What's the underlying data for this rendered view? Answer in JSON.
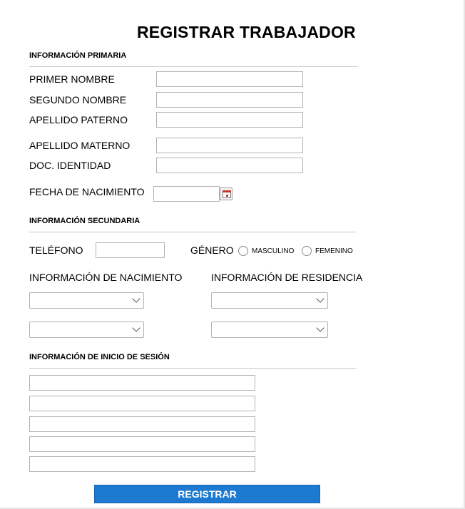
{
  "title": "REGISTRAR TRABAJADOR",
  "primary": {
    "heading": "INFORMACIÓN PRIMARIA",
    "labels": {
      "primer_nombre": "PRIMER NOMBRE",
      "segundo_nombre": "SEGUNDO NOMBRE",
      "apellido_paterno": "APELLIDO PATERNO",
      "apellido_materno": "APELLIDO MATERNO",
      "doc_identidad": "DOC. IDENTIDAD",
      "fecha_nacimiento": "FECHA DE NACIMIENTO"
    },
    "values": {
      "primer_nombre": "",
      "segundo_nombre": "",
      "apellido_paterno": "",
      "apellido_materno": "",
      "doc_identidad": "",
      "fecha_nacimiento": ""
    },
    "calendar_icon": "calendar-icon"
  },
  "secondary": {
    "heading": "INFORMACIÓN SECUNDARIA",
    "telefono_label": "TELÉFONO",
    "telefono_value": "",
    "genero_label": "GÉNERO",
    "genero_options": [
      "MASCULINO",
      "FEMENINO"
    ],
    "nacimiento_label": "INFORMACIÓN DE NACIMIENTO",
    "residencia_label": "INFORMACIÓN DE RESIDENCIA",
    "selects": {
      "nacimiento_1": "",
      "nacimiento_2": "",
      "residencia_1": "",
      "residencia_2": ""
    }
  },
  "login": {
    "heading": "INFORMACIÓN DE INICIO DE SESIÓN",
    "fields": [
      "",
      "",
      "",
      "",
      ""
    ]
  },
  "submit_label": "REGISTRAR",
  "colors": {
    "button": "#1e79d0",
    "rule": "#c8c8c8",
    "border": "#b3b3b3"
  }
}
